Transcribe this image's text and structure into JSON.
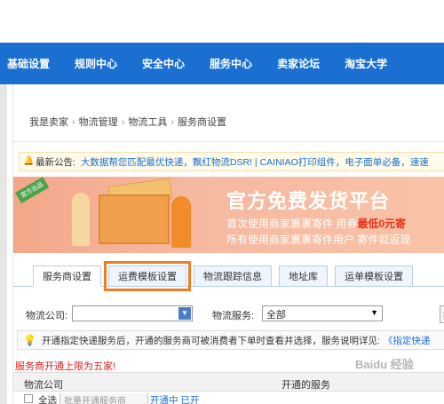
{
  "nav": [
    "基础设置",
    "规则中心",
    "安全中心",
    "服务中心",
    "卖家论坛",
    "淘宝大学"
  ],
  "breadcrumb": [
    "我是卖家",
    "物流管理",
    "物流工具",
    "服务商设置"
  ],
  "announcement": {
    "label": "最新公告:",
    "links": "大数据帮您匹配最优快递，飘红物流DSR! | CAINIAO打印组件，电子面单必备，速速"
  },
  "banner": {
    "title": "官方免费发货平台",
    "line1_prefix": "首次使用商家裹裹寄件  用券",
    "line1_highlight": "最低0元寄",
    "line2": "所有使用商家裹裹寄件用户 寄件就返现",
    "ribbon": "官方出品"
  },
  "tabs": [
    "服务商设置",
    "运费模板设置",
    "物流跟踪信息",
    "地址库",
    "运单模板设置"
  ],
  "filter": {
    "company_label": "物流公司:",
    "company_value": "",
    "service_label": "物流服务:",
    "service_value": "全部",
    "search_label": "搜"
  },
  "tip": {
    "text": "开通指定快递服务后，开通的服务商可被消费者下单时查看并选择，服务说明详见:",
    "link": "《指定快递"
  },
  "limit_notice": "服务商开通上限为五家!",
  "table": {
    "col1": "物流公司",
    "col2": "开通的服务",
    "row_select_all": "全选",
    "row_button": "批量开通服务商",
    "row_link": "开通中 已开"
  },
  "watermark": "Baidu 经验"
}
